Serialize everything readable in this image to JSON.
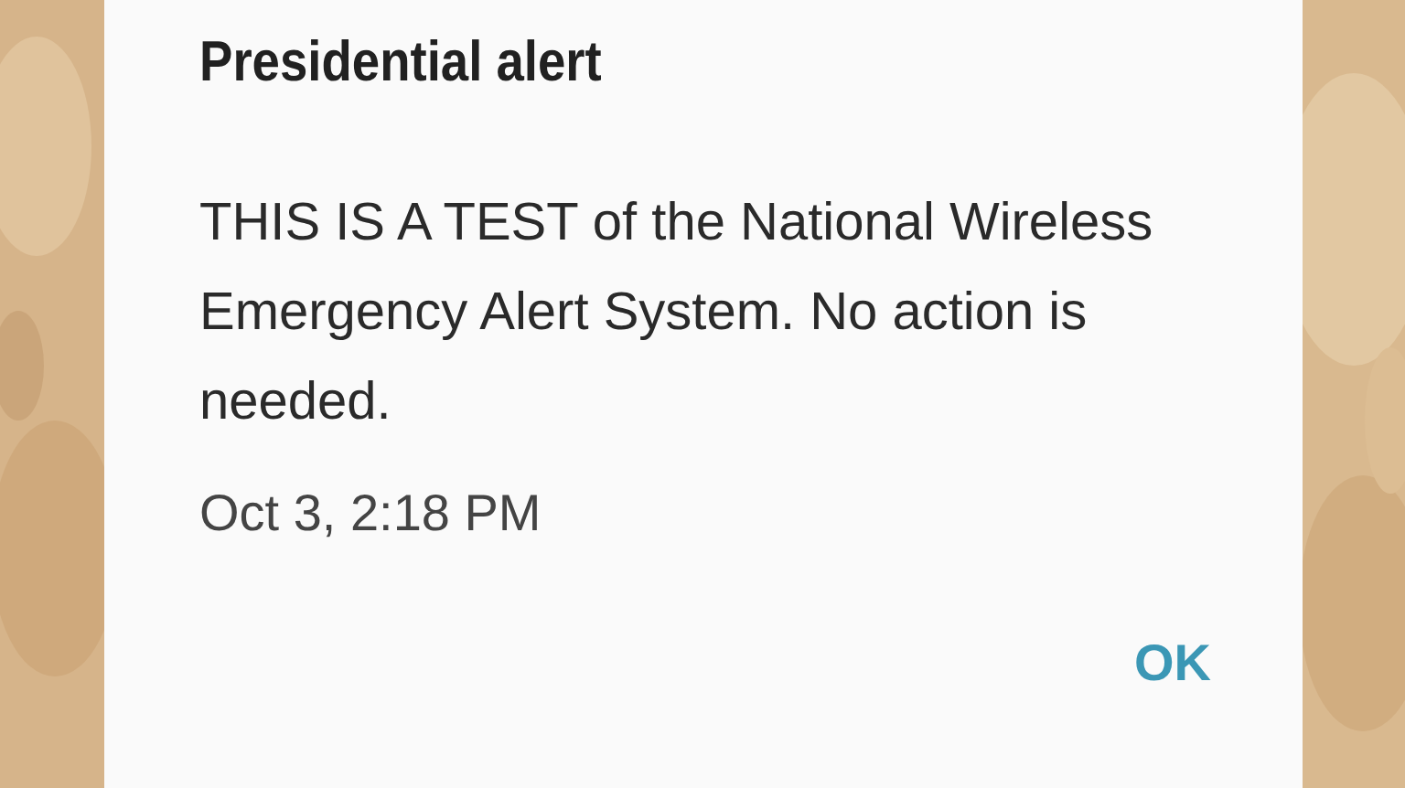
{
  "dialog": {
    "title": "Presidential alert",
    "message": "THIS IS A TEST of the National Wireless Emergency Alert System. No action is needed.",
    "timestamp": "Oct 3, 2:18 PM",
    "buttons": [
      "OK"
    ]
  }
}
